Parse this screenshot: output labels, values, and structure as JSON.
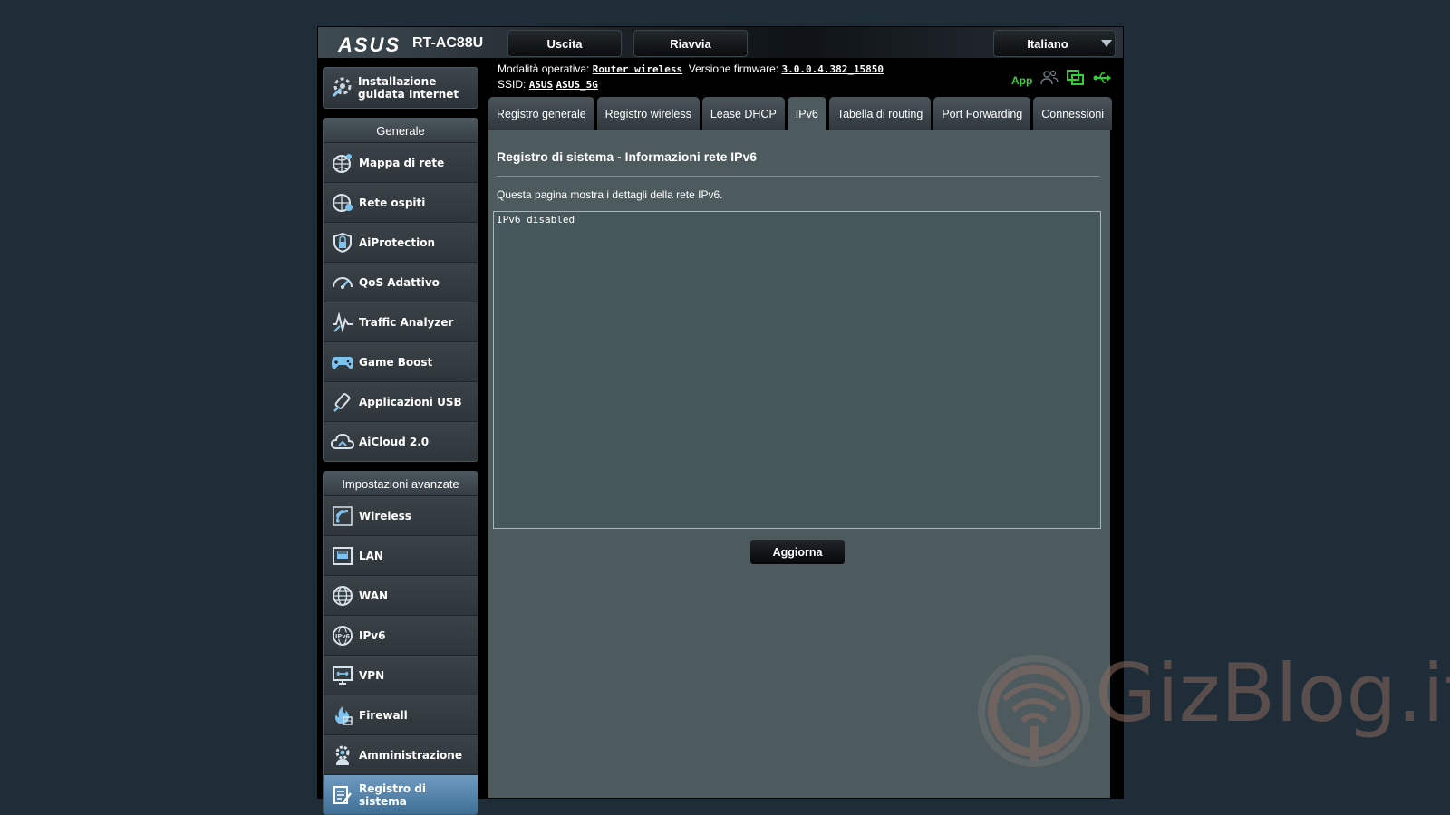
{
  "header": {
    "brand": "ASUS",
    "model": "RT-AC88U",
    "logout_label": "Uscita",
    "reboot_label": "Riavvia",
    "language": "Italiano"
  },
  "status": {
    "mode_label": "Modalità operativa:",
    "mode_value": "Router wireless",
    "firmware_label": "Versione firmware:",
    "firmware_value": "3.0.0.4.382_15850",
    "ssid_label": "SSID:",
    "ssid_values": [
      "ASUS",
      "ASUS_5G"
    ],
    "app_label": "App"
  },
  "sidebar": {
    "qis_label_line1": "Installazione",
    "qis_label_line2": "guidata Internet",
    "general_title": "Generale",
    "general_items": [
      {
        "label": "Mappa di rete",
        "icon": "network-map-icon"
      },
      {
        "label": "Rete ospiti",
        "icon": "guest-network-icon"
      },
      {
        "label": "AiProtection",
        "icon": "lock-shield-icon"
      },
      {
        "label": "QoS Adattivo",
        "icon": "speedometer-icon"
      },
      {
        "label": "Traffic Analyzer",
        "icon": "traffic-wave-icon"
      },
      {
        "label": "Game Boost",
        "icon": "gamepad-icon"
      },
      {
        "label": "Applicazioni USB",
        "icon": "usb-apps-icon"
      },
      {
        "label": "AiCloud 2.0",
        "icon": "cloud-icon"
      }
    ],
    "advanced_title": "Impostazioni avanzate",
    "advanced_items": [
      {
        "label": "Wireless",
        "icon": "wifi-icon"
      },
      {
        "label": "LAN",
        "icon": "lan-port-icon"
      },
      {
        "label": "WAN",
        "icon": "globe-icon"
      },
      {
        "label": "IPv6",
        "icon": "ipv6-globe-icon"
      },
      {
        "label": "VPN",
        "icon": "vpn-monitor-icon"
      },
      {
        "label": "Firewall",
        "icon": "firewall-icon"
      },
      {
        "label": "Amministrazione",
        "icon": "admin-gear-icon"
      },
      {
        "label": "Registro di sistema",
        "icon": "system-log-icon"
      }
    ]
  },
  "tabs": [
    {
      "label": "Registro generale"
    },
    {
      "label": "Registro wireless"
    },
    {
      "label": "Lease DHCP"
    },
    {
      "label": "IPv6",
      "active": true
    },
    {
      "label": "Tabella di routing"
    },
    {
      "label": "Port Forwarding"
    },
    {
      "label": "Connessioni"
    }
  ],
  "main": {
    "title": "Registro di sistema - Informazioni rete IPv6",
    "description": "Questa pagina mostra i dettagli della rete IPv6.",
    "log_text": "IPv6 disabled",
    "refresh_label": "Aggiorna"
  },
  "watermark": {
    "text": "GizBlog.it"
  },
  "colors": {
    "background": "#1f2d38",
    "content_panel": "#4d5b5f",
    "active_menu": "#4f7fa8",
    "status_green": "#3fd13f"
  }
}
